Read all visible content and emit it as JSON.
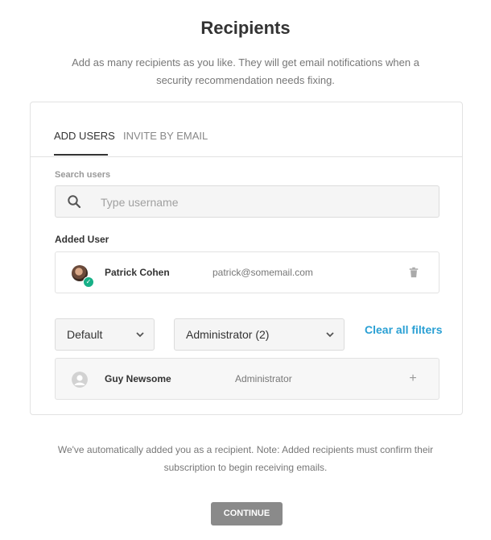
{
  "header": {
    "title": "Recipients",
    "subtitle": "Add as many recipients as you like. They will get email notifications when a security recommendation needs fixing."
  },
  "tabs": [
    {
      "label": "ADD USERS",
      "active": true
    },
    {
      "label": "INVITE BY EMAIL",
      "active": false
    }
  ],
  "search": {
    "label": "Search users",
    "placeholder": "Type username",
    "value": ""
  },
  "added": {
    "label": "Added User",
    "user": {
      "name": "Patrick Cohen",
      "email": "patrick@somemail.com",
      "action_icon": "trash-icon"
    }
  },
  "filters": {
    "first": {
      "selected": "Default"
    },
    "second": {
      "selected": "Administrator (2)"
    },
    "clear_label": "Clear all filters"
  },
  "results": [
    {
      "name": "Guy Newsome",
      "role": "Administrator",
      "action_icon": "plus-icon"
    }
  ],
  "footer": {
    "note": "We've automatically added you as a recipient. Note: Added recipients must confirm their subscription to begin receiving emails.",
    "continue_label": "CONTINUE"
  },
  "colors": {
    "accent": "#2aa0d4",
    "success": "#17b087",
    "button": "#8a8a8a"
  }
}
